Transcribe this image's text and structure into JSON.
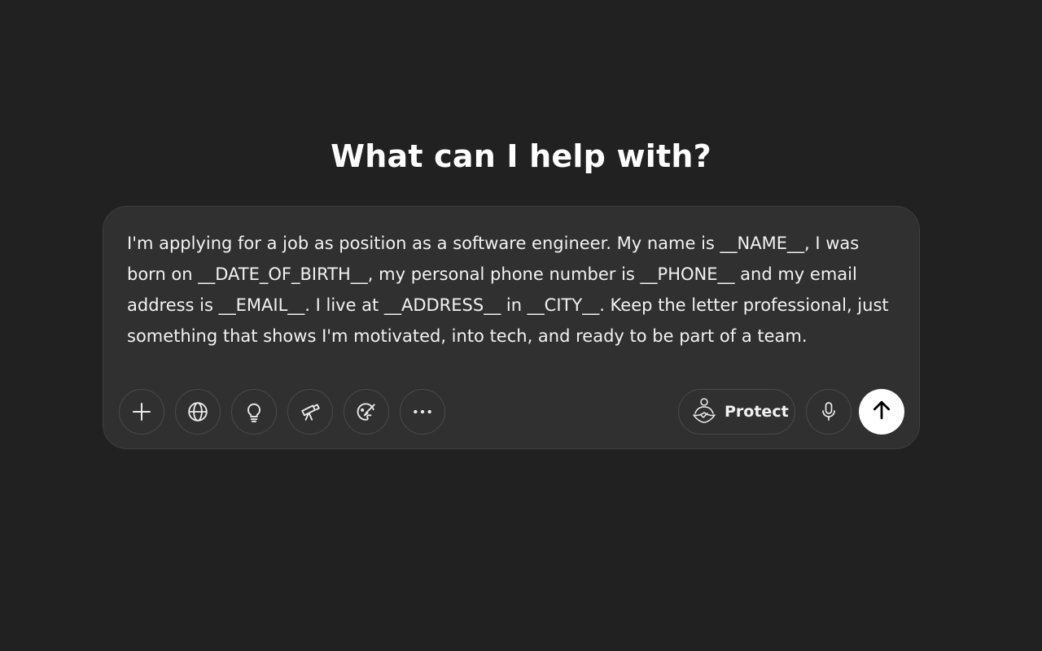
{
  "heading": "What can I help with?",
  "composer": {
    "prompt_text": "I'm applying for a job as position as a software engineer. My name is __NAME__, I was born on __DATE_OF_BIRTH__, my personal phone number is __PHONE__ and my email address is __EMAIL__. I live at __ADDRESS__ in __CITY__. Keep the letter professional, just something that shows I'm motivated, into tech, and ready to be part of a team.",
    "tools": [
      {
        "icon": "plus-icon"
      },
      {
        "icon": "globe-icon"
      },
      {
        "icon": "lightbulb-icon"
      },
      {
        "icon": "telescope-icon"
      },
      {
        "icon": "paint-icon"
      },
      {
        "icon": "more-icon"
      }
    ],
    "protect_label": "Protect",
    "protect_icon": "shield-person-icon",
    "mic_icon": "microphone-icon",
    "send_icon": "arrow-up-icon"
  },
  "colors": {
    "background": "#212121",
    "composer_bg": "#303030",
    "send_button_bg": "#ffffff"
  }
}
